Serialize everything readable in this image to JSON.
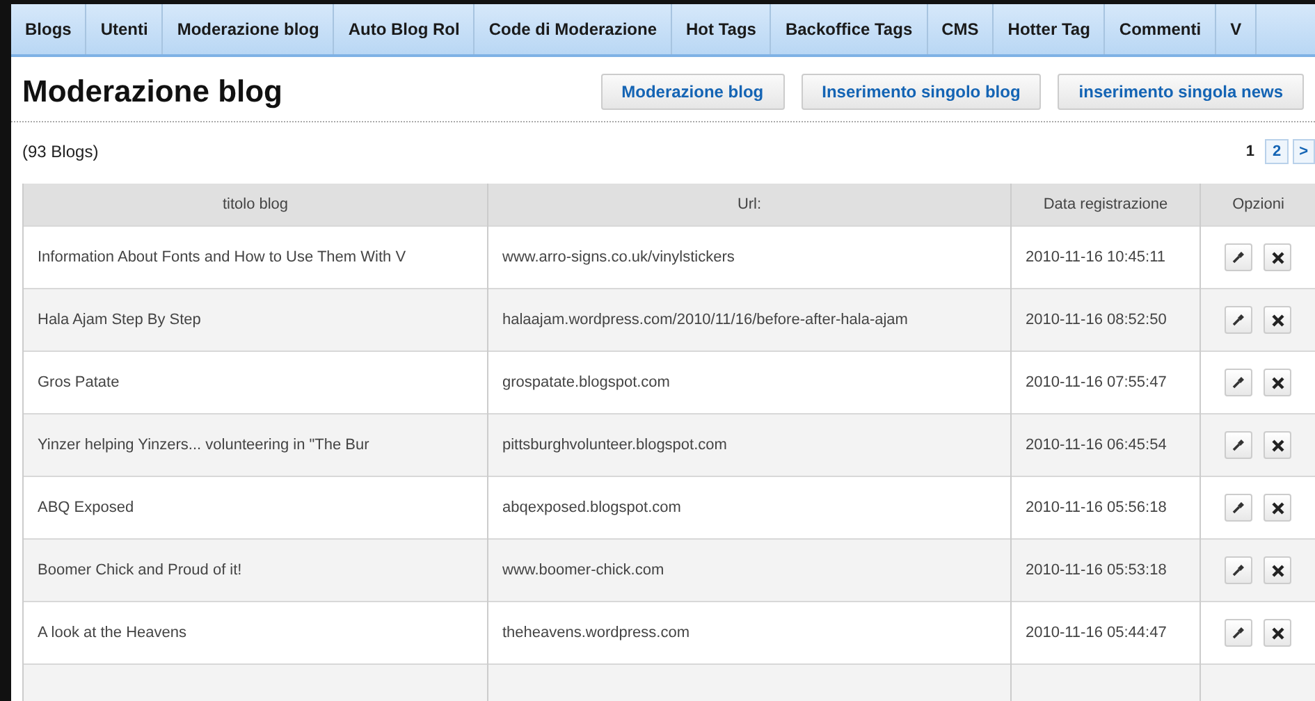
{
  "nav": [
    {
      "label": "Blogs"
    },
    {
      "label": "Utenti"
    },
    {
      "label": "Moderazione blog"
    },
    {
      "label": "Auto Blog Rol"
    },
    {
      "label": "Code di Moderazione"
    },
    {
      "label": "Hot Tags"
    },
    {
      "label": "Backoffice Tags"
    },
    {
      "label": "CMS"
    },
    {
      "label": "Hotter Tag"
    },
    {
      "label": "Commenti"
    },
    {
      "label": "V"
    }
  ],
  "page_title": "Moderazione blog",
  "actions": [
    "Moderazione blog",
    "Inserimento singolo blog",
    "inserimento singola news"
  ],
  "count": "(93 Blogs)",
  "pager": [
    {
      "label": "1",
      "selected": true
    },
    {
      "label": "2",
      "selected": false
    },
    {
      "label": ">",
      "selected": false
    }
  ],
  "table": {
    "columns": [
      "titolo blog",
      "Url:",
      "Data registrazione",
      "Opzioni"
    ],
    "rows": [
      {
        "title": "Information About Fonts and How to Use Them With V",
        "url": "www.arro-signs.co.uk/vinylstickers",
        "date": "2010-11-16 10:45:11"
      },
      {
        "title": "Hala Ajam Step By Step",
        "url": "halaajam.wordpress.com/2010/11/16/before-after-hala-ajam",
        "date": "2010-11-16 08:52:50"
      },
      {
        "title": "Gros Patate",
        "url": "grospatate.blogspot.com",
        "date": "2010-11-16 07:55:47"
      },
      {
        "title": "Yinzer helping Yinzers... volunteering in \"The Bur",
        "url": "pittsburghvolunteer.blogspot.com",
        "date": "2010-11-16 06:45:54"
      },
      {
        "title": "ABQ Exposed",
        "url": "abqexposed.blogspot.com",
        "date": "2010-11-16 05:56:18"
      },
      {
        "title": "Boomer Chick and Proud of it!",
        "url": "www.boomer-chick.com",
        "date": "2010-11-16 05:53:18"
      },
      {
        "title": "A look at the Heavens",
        "url": "theheavens.wordpress.com",
        "date": "2010-11-16 05:44:47"
      }
    ]
  }
}
